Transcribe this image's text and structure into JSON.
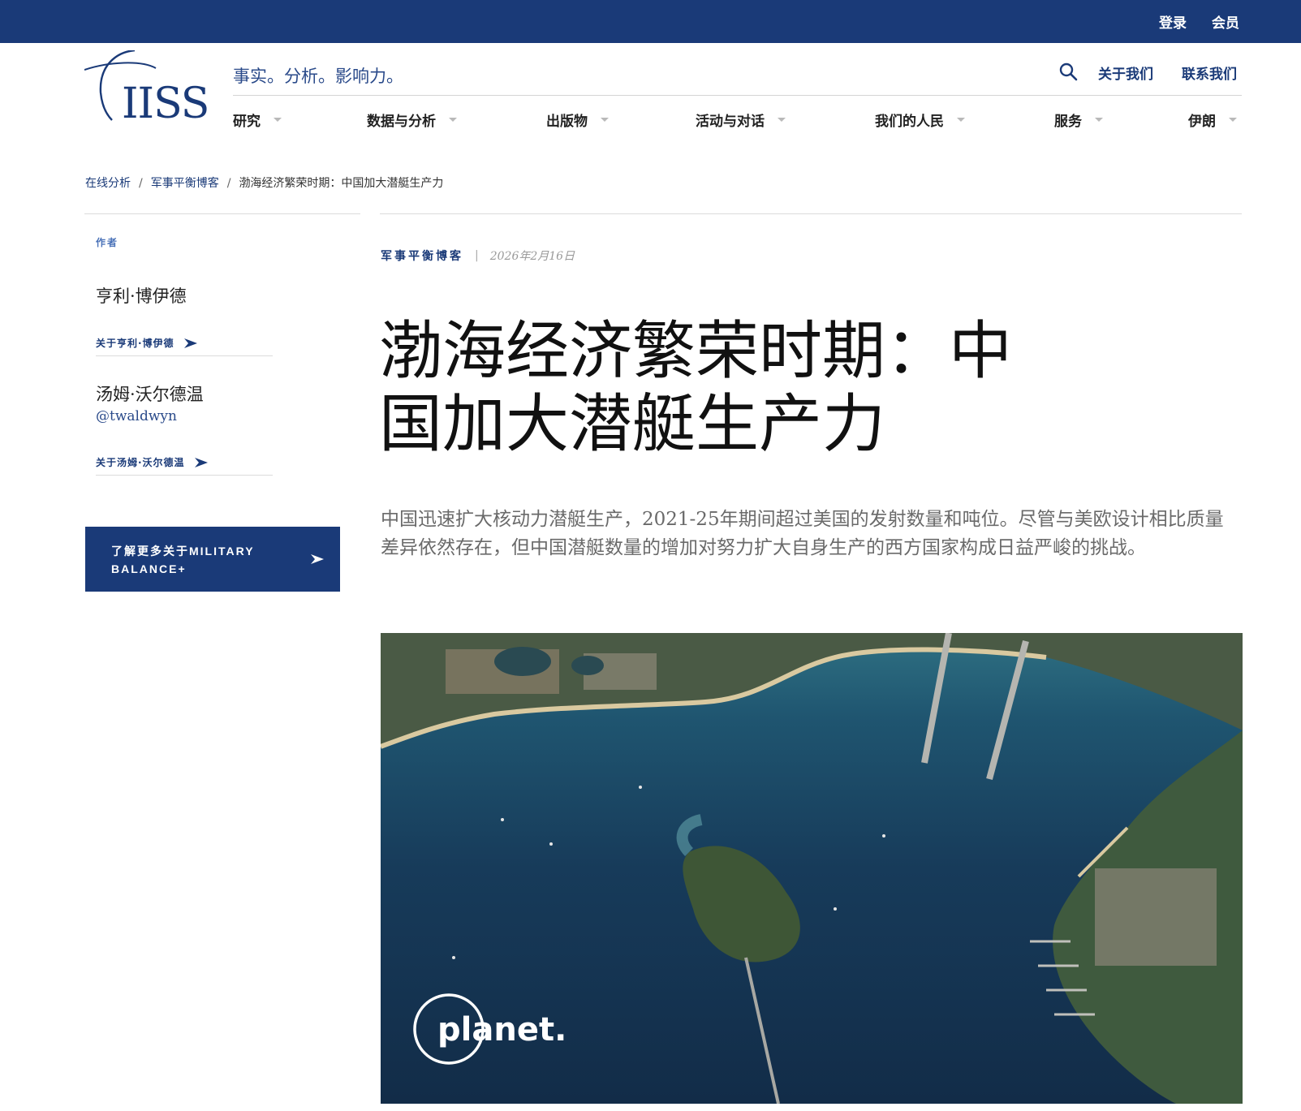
{
  "topbar": {
    "login": "登录",
    "membership": "会员"
  },
  "logo": {
    "text": "IISS"
  },
  "header": {
    "tagline": "事实。分析。影响力。",
    "util_links": {
      "about": "关于我们",
      "contact": "联系我们"
    }
  },
  "nav": {
    "items": [
      {
        "label": "研究"
      },
      {
        "label": "数据与分析"
      },
      {
        "label": "出版物"
      },
      {
        "label": "活动与对话"
      },
      {
        "label": "我们的人民"
      },
      {
        "label": "服务"
      },
      {
        "label": "伊朗"
      }
    ]
  },
  "breadcrumb": {
    "items": [
      {
        "label": "在线分析"
      },
      {
        "label": "军事平衡博客"
      },
      {
        "label": "渤海经济繁荣时期：中国加大潜艇生产力"
      }
    ],
    "separator": "/"
  },
  "sidebar": {
    "authors_heading": "作者",
    "authors": [
      {
        "name": "亨利·博伊德",
        "handle": "",
        "about": "关于亨利·博伊德"
      },
      {
        "name": "汤姆·沃尔德温",
        "handle": "@twaldwyn",
        "about": "关于汤姆·沃尔德温"
      }
    ],
    "cta_button": "了解更多关于MILITARY BALANCE+"
  },
  "article": {
    "category": "军事平衡博客",
    "date_separator": "|",
    "date": "2026年2月16日",
    "title": "渤海经济繁荣时期：中国加大潜艇生产力",
    "lead": "中国迅速扩大核动力潜艇生产，2021-25年期间超过美国的发射数量和吨位。尽管与美欧设计相比质量差异依然存在，但中国潜艇数量的增加对努力扩大自身生产的西方国家构成日益严峻的挑战。",
    "image_watermark": "planet."
  },
  "colors": {
    "brand_navy": "#1a3a78",
    "link_blue": "#2a4a8a",
    "author_heading": "#4a72b8",
    "lead_text": "#6a6a6a",
    "sea": "#14304f"
  },
  "icons": {
    "search": "search-icon",
    "arrow": "arrow-right-icon",
    "chevron": "chevron-down-icon"
  }
}
